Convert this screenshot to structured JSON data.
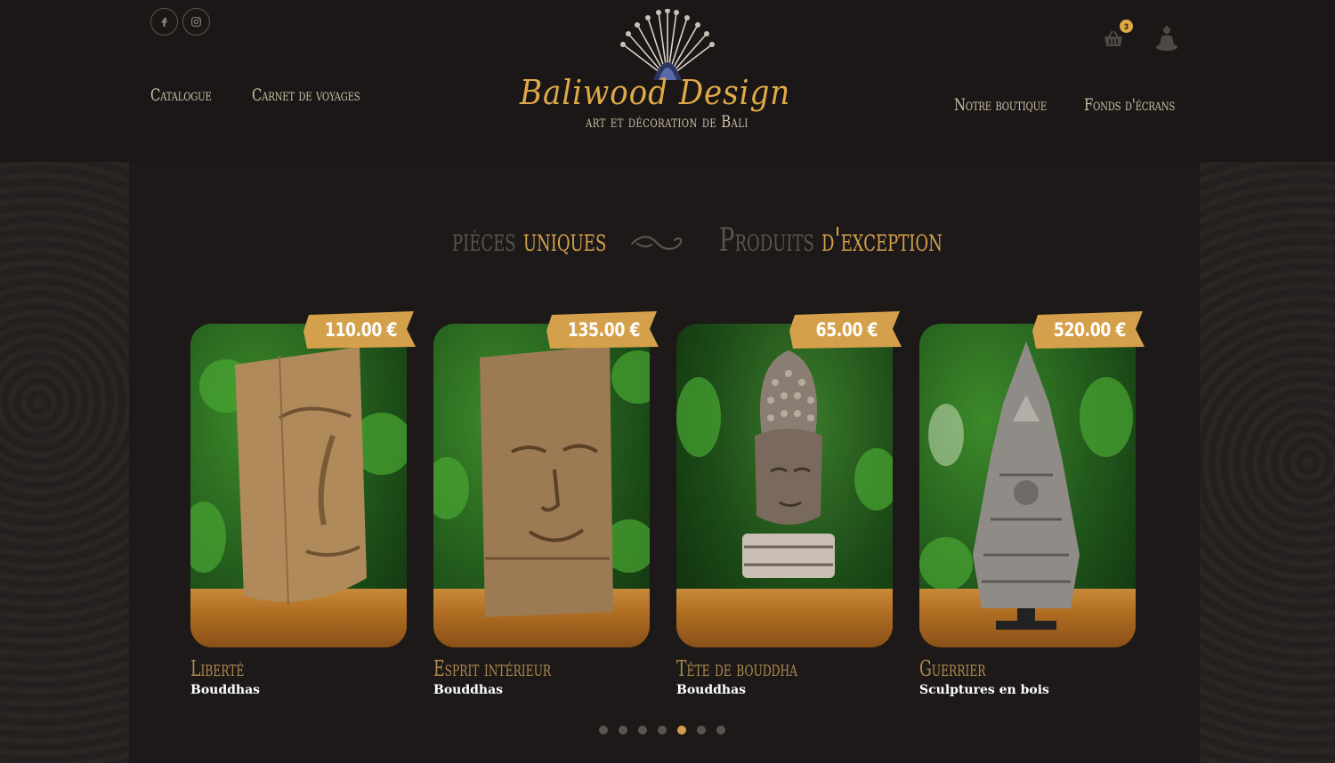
{
  "header": {
    "social": [
      {
        "name": "facebook",
        "icon": "facebook-icon"
      },
      {
        "name": "instagram",
        "icon": "instagram-icon"
      }
    ],
    "nav_left": [
      "Catalogue",
      "Carnet de voyages"
    ],
    "nav_right": [
      "Notre boutique",
      "Fonds d'écrans"
    ],
    "logo": {
      "name": "Baliwood Design",
      "tagline": "art et décoration de Bali"
    },
    "cart": {
      "icon": "basket-icon",
      "count": "3"
    },
    "account": {
      "icon": "buddha-user-icon"
    }
  },
  "headline": {
    "left_muted": "pièces ",
    "left_gold": "uniques",
    "right_muted": "Produits ",
    "right_gold": "d'exception"
  },
  "products": [
    {
      "title": "Liberté",
      "category": "Bouddhas",
      "price": "110.00 €"
    },
    {
      "title": "Esprit intérieur",
      "category": "Bouddhas",
      "price": "135.00 €"
    },
    {
      "title": "Tête de bouddha",
      "category": "Bouddhas",
      "price": "65.00 €"
    },
    {
      "title": "Guerrier",
      "category": "Sculptures en bois",
      "price": "520.00 €"
    }
  ],
  "carousel": {
    "total": 7,
    "active": 5
  },
  "colors": {
    "accent": "#d4a04b",
    "background": "#1c1918",
    "nav_text": "#cdbfa6"
  }
}
